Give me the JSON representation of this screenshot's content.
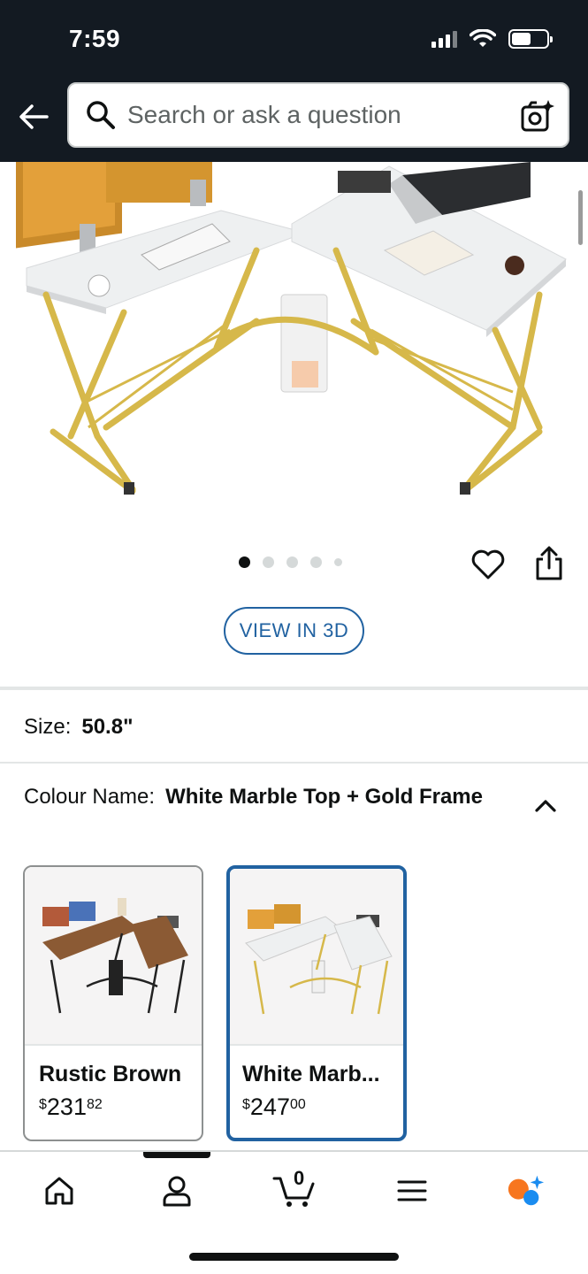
{
  "status_bar": {
    "time": "7:59"
  },
  "header": {
    "search": {
      "placeholder": "Search or ask a question"
    }
  },
  "product": {
    "image_alt": "L-shaped desk, white marble top with gold frame",
    "image_dots": {
      "total": 5,
      "active": 1
    },
    "view_3d_label": "VIEW IN 3D"
  },
  "size": {
    "label": "Size:",
    "value": "50.8\""
  },
  "colour": {
    "label": "Colour Name:",
    "value": "White Marble Top + Gold Frame"
  },
  "swatches": [
    {
      "name": "Rustic Brown",
      "price_symbol": "$",
      "price_whole": "231",
      "price_cents": "82",
      "selected": false
    },
    {
      "name": "White Marb...",
      "price_symbol": "$",
      "price_whole": "247",
      "price_cents": "00",
      "selected": true
    }
  ],
  "bottom_nav": {
    "cart_count": "0"
  },
  "colors": {
    "header_bg": "#131a22",
    "accent_blue": "#2162a1",
    "gold": "#d6b84a"
  }
}
